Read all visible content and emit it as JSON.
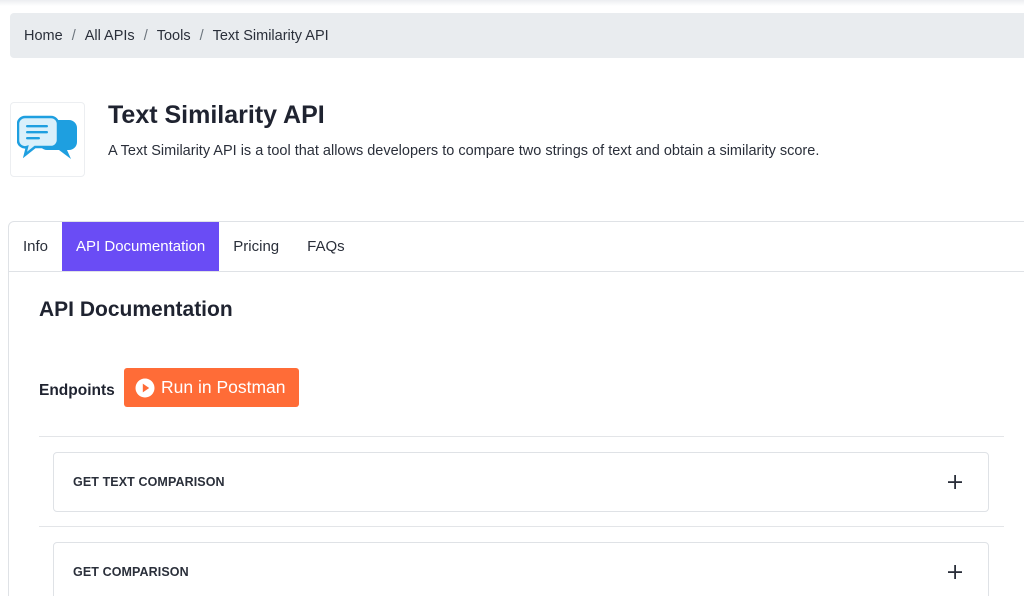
{
  "breadcrumb": {
    "items": [
      "Home",
      "All APIs",
      "Tools",
      "Text Similarity API"
    ],
    "separator": "/"
  },
  "api": {
    "logo_icon": "chat-bubbles-icon",
    "title": "Text Similarity API",
    "description": "A Text Similarity API is a tool that allows developers to compare two strings of text and obtain a similarity score."
  },
  "tabs": [
    {
      "label": "Info",
      "active": false
    },
    {
      "label": "API Documentation",
      "active": true
    },
    {
      "label": "Pricing",
      "active": false
    },
    {
      "label": "FAQs",
      "active": false
    }
  ],
  "documentation": {
    "heading": "API Documentation",
    "endpoints_label": "Endpoints",
    "postman_button": "Run in Postman",
    "endpoints": [
      {
        "name": "GET TEXT COMPARISON",
        "expand_icon": "plus-icon"
      },
      {
        "name": "GET COMPARISON",
        "expand_icon": "plus-icon"
      }
    ]
  },
  "colors": {
    "active_tab": "#6a4cf5",
    "postman": "#ff6c37",
    "breadcrumb_bg": "#e9ecef"
  }
}
